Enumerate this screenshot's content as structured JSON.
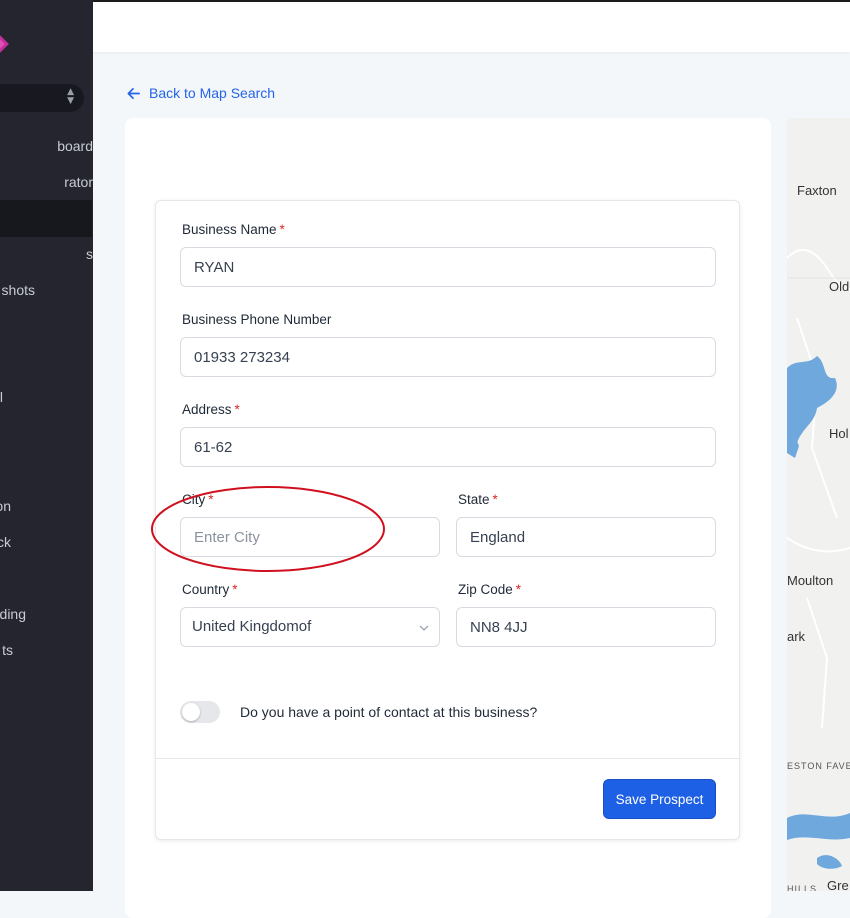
{
  "sidebar": {
    "items": [
      {
        "label": "board"
      },
      {
        "label": "rator"
      },
      {
        "label": ""
      },
      {
        "label": "s"
      },
      {
        "label": "shots"
      },
      {
        "label": "l"
      },
      {
        "label": "on"
      },
      {
        "label": "ck"
      },
      {
        "label": "ding"
      },
      {
        "label": "ts"
      }
    ]
  },
  "nav": {
    "back_label": "Back to Map Search"
  },
  "form": {
    "business_name": {
      "label": "Business Name",
      "required": "*",
      "value": "RYAN"
    },
    "phone": {
      "label": "Business Phone Number",
      "value": "01933 273234"
    },
    "address": {
      "label": "Address",
      "required": "*",
      "value": "61-62"
    },
    "city": {
      "label": "City",
      "required": "*",
      "value": "",
      "placeholder": "Enter City"
    },
    "state": {
      "label": "State",
      "required": "*",
      "value": "England"
    },
    "country": {
      "label": "Country",
      "required": "*",
      "value": "United Kingdomof"
    },
    "zip": {
      "label": "Zip Code",
      "required": "*",
      "value": "NN8 4JJ"
    },
    "contact_toggle": {
      "label": "Do you have a point of contact at this business?",
      "on": false
    },
    "save_label": "Save Prospect"
  },
  "map": {
    "labels": [
      "Faxton",
      "Old",
      "Hol",
      "Moulton",
      "ark",
      "ESTON FAVEL",
      "HILLS",
      "Gre"
    ]
  },
  "colors": {
    "accent": "#1d5fe5",
    "link": "#2563eb",
    "required": "#dc2626",
    "annotation": "#d0101e",
    "sidebar": "#24252f"
  }
}
